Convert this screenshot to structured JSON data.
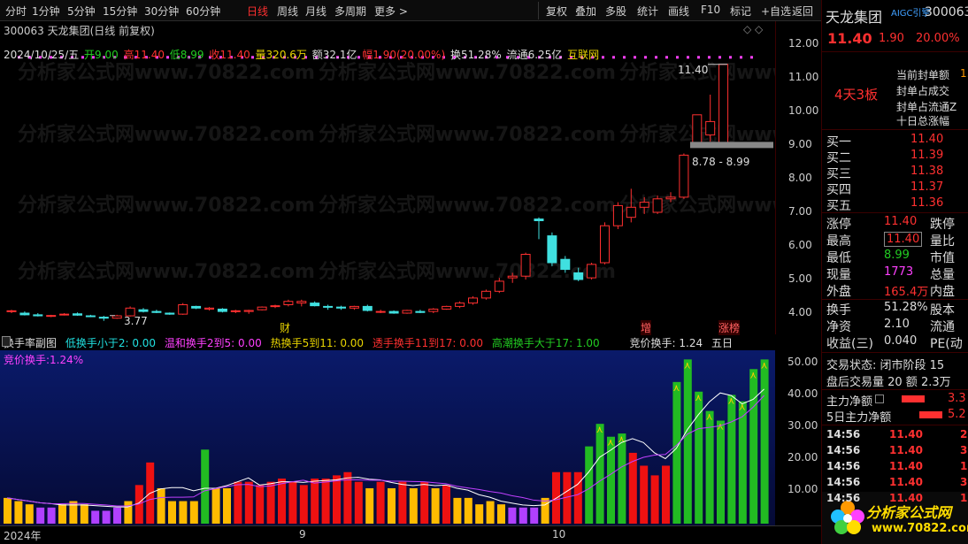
{
  "toolbar": {
    "left": [
      "分时",
      "1分钟",
      "5分钟",
      "15分钟",
      "30分钟",
      "60分钟",
      "日线",
      "周线",
      "月线",
      "多周期",
      "更多 >"
    ],
    "active": "日线",
    "right": [
      "复权",
      "叠加",
      "多股",
      "统计",
      "画线",
      "F10",
      "标记",
      "+自选",
      "返回"
    ]
  },
  "chart": {
    "title": "300063 天龙集团(日线 前复权)",
    "diamond_icons": "◇ ◇",
    "ohlc": {
      "date": "2024/10/25/五",
      "open": "开9.00",
      "high": "高11.40",
      "low": "低8.99",
      "close": "收11.40",
      "volume": "量320.6万",
      "amount": "额32.1亿",
      "change": "幅1.90(20.00%)",
      "turnover": "换51.28%",
      "float": "流通6.25亿",
      "concept": "互联网"
    },
    "price_ticks": [
      "12.00",
      "11.00",
      "10.00",
      "9.00",
      "8.00",
      "7.00",
      "6.00",
      "5.00",
      "4.00"
    ],
    "annotations": {
      "high_label": "11.40",
      "low_label": "3.77",
      "range_label": "8.78 - 8.99",
      "event_cai": "财",
      "event_zeng": "增",
      "event_zhangbang": "涨榜"
    },
    "watermark": "分析家公式网www.70822.com"
  },
  "sub_chart": {
    "legend": {
      "title": "换手率副图",
      "low": "低换手小于2: 0.00",
      "mild": "温和换手2到5: 0.00",
      "hot": "热换手5到11: 0.00",
      "penetrate": "透手换手11到17: 0.00",
      "peak": "高潮换手大于17: 1.00",
      "tail": "竞价换手: 1.24",
      "tail_period": "五日"
    },
    "bid_label": "竞价换手:1.24%",
    "ticks": [
      "50.00",
      "40.00",
      "30.00",
      "20.00",
      "10.00"
    ]
  },
  "time_axis": [
    "2024年",
    "9",
    "10"
  ],
  "right_panel": {
    "name": "天龙集团",
    "aigc": "AIGC引擎",
    "code": "300063",
    "price": "11.40",
    "change": "1.90",
    "change_pct": "20.00%",
    "board_label": "4天3板",
    "seal_items": [
      "当前封单额",
      "封单占成交",
      "封单占流通Z",
      "十日总涨幅"
    ],
    "seal_values": [
      "1.",
      "",
      "",
      ""
    ],
    "bids": [
      {
        "label": "买一",
        "price": "11.40",
        "vol": ""
      },
      {
        "label": "买二",
        "price": "11.39",
        "vol": ""
      },
      {
        "label": "买三",
        "price": "11.38",
        "vol": ""
      },
      {
        "label": "买四",
        "price": "11.37",
        "vol": ""
      },
      {
        "label": "买五",
        "price": "11.36",
        "vol": ""
      }
    ],
    "quote": [
      {
        "k1": "涨停",
        "v1": "11.40",
        "k2": "跌停"
      },
      {
        "k1": "最高",
        "v1": "11.40",
        "k2": "量比"
      },
      {
        "k1": "最低",
        "v1": "8.99",
        "k2": "市值"
      },
      {
        "k1": "现量",
        "v1": "1773",
        "k2": "总量"
      },
      {
        "k1": "外盘",
        "v1": "165.4万",
        "k2": "内盘"
      }
    ],
    "quote2": [
      {
        "k1": "换手",
        "v1": "51.28%",
        "k2": "股本"
      },
      {
        "k1": "净资",
        "v1": "2.10",
        "k2": "流通"
      },
      {
        "k1": "收益(三)",
        "v1": "0.040",
        "k2": "PE(动"
      }
    ],
    "trade_state": "交易状态: 闭市阶段 15",
    "after_hours": "盘后交易量 20 额 2.3万",
    "main_net": "主力净额",
    "main_net_val": "3.3",
    "main_net5": "5日主力净额",
    "main_net5_val": "5.2",
    "ticks": [
      {
        "time": "14:56",
        "price": "11.40",
        "vol": "2"
      },
      {
        "time": "14:56",
        "price": "11.40",
        "vol": "3"
      },
      {
        "time": "14:56",
        "price": "11.40",
        "vol": "1"
      },
      {
        "time": "14:56",
        "price": "11.40",
        "vol": "3"
      },
      {
        "time": "14:56",
        "price": "11.40",
        "vol": "1"
      }
    ],
    "logo_text": "分析家公式网",
    "logo_url": "www.70822.com"
  },
  "colors": {
    "up": "#ff3030",
    "down": "#40e0e0",
    "bg": "#000000",
    "sub_bg": "#0a1a6a"
  }
}
